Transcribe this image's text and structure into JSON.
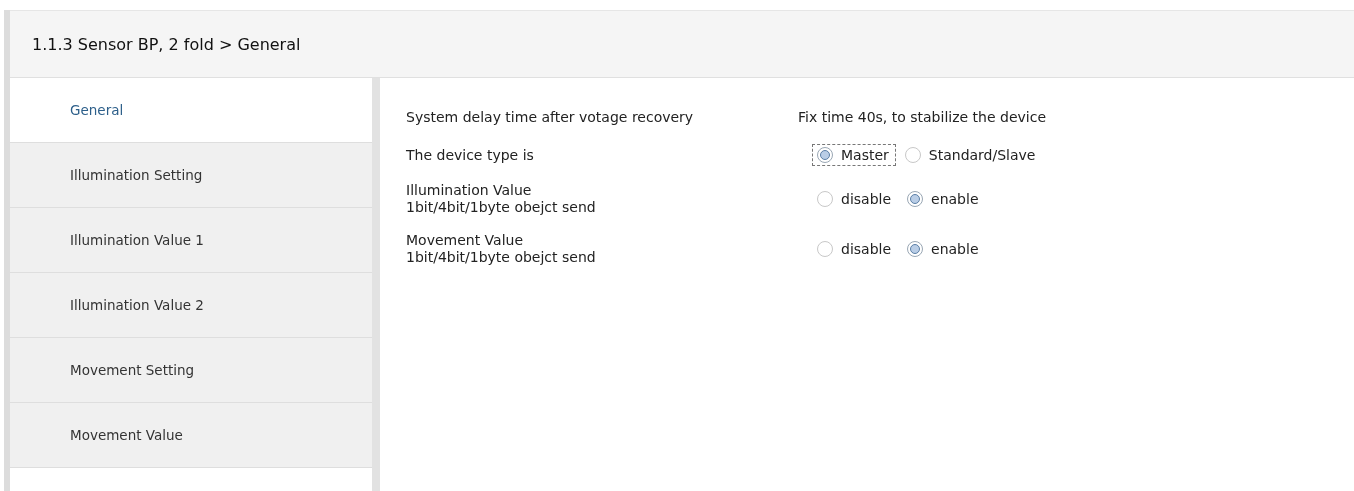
{
  "header": {
    "title": "1.1.3 Sensor BP, 2 fold > General"
  },
  "sidebar": {
    "items": [
      {
        "label": "General",
        "selected": true
      },
      {
        "label": "Illumination Setting",
        "selected": false
      },
      {
        "label": "Illumination Value 1",
        "selected": false
      },
      {
        "label": "Illumination Value 2",
        "selected": false
      },
      {
        "label": "Movement Setting",
        "selected": false
      },
      {
        "label": "Movement Value",
        "selected": false
      }
    ]
  },
  "parameters": [
    {
      "kind": "text",
      "label": "System delay time after votage recovery",
      "value": "Fix time 40s, to stabilize the device"
    },
    {
      "kind": "radio",
      "label": "The device type is",
      "options": [
        {
          "label": "Master",
          "selected": true,
          "focused": true
        },
        {
          "label": "Standard/Slave",
          "selected": false,
          "focused": false
        }
      ]
    },
    {
      "kind": "radio",
      "label": "Illumination Value\n1bit/4bit/1byte obejct send",
      "options": [
        {
          "label": "disable",
          "selected": false,
          "focused": false
        },
        {
          "label": "enable",
          "selected": true,
          "focused": false
        }
      ]
    },
    {
      "kind": "radio",
      "label": "Movement Value\n1bit/4bit/1byte obejct send",
      "options": [
        {
          "label": "disable",
          "selected": false,
          "focused": false
        },
        {
          "label": "enable",
          "selected": true,
          "focused": false
        }
      ]
    }
  ]
}
